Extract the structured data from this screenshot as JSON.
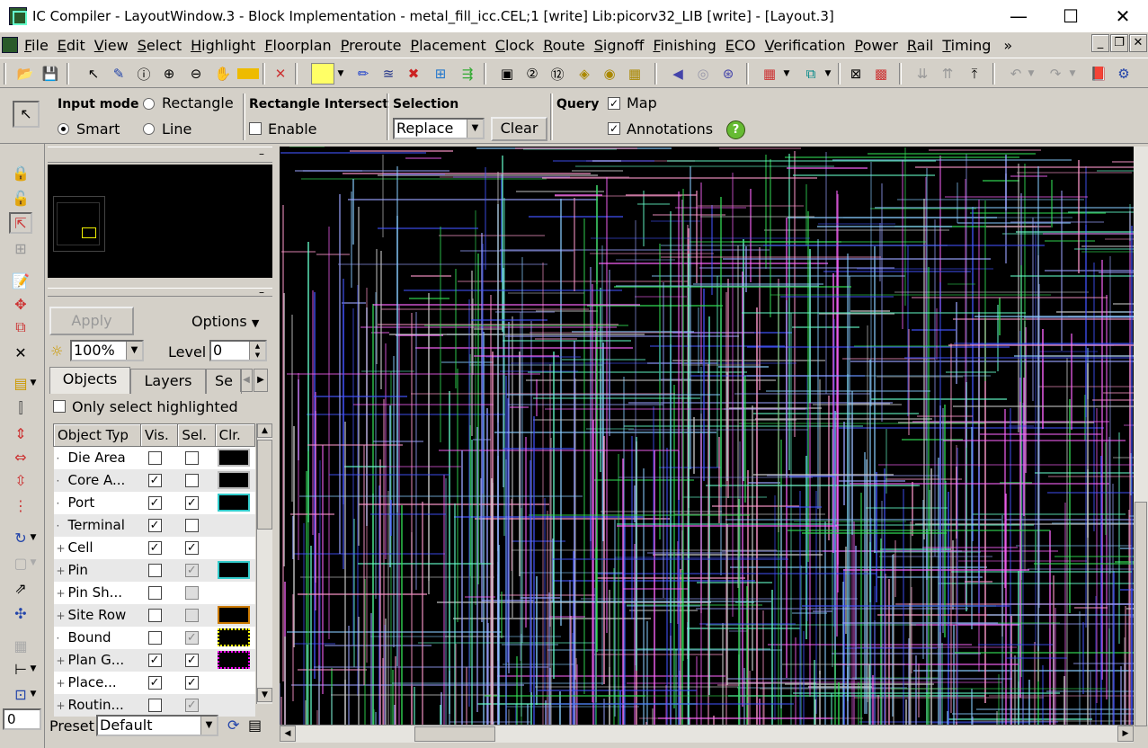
{
  "window": {
    "title": "IC Compiler - LayoutWindow.3 - Block Implementation - metal_fill_icc.CEL;1 [write]    Lib:picorv32_LIB [write] - [Layout.3]",
    "minimize": "—",
    "maximize": "☐",
    "close": "✕"
  },
  "menubar": {
    "items": [
      "File",
      "Edit",
      "View",
      "Select",
      "Highlight",
      "Floorplan",
      "Preroute",
      "Placement",
      "Clock",
      "Route",
      "Signoff",
      "Finishing",
      "ECO",
      "Verification",
      "Power",
      "Rail",
      "Timing"
    ],
    "overflow": "»"
  },
  "mdi_controls": {
    "minimize": "_",
    "restore": "❐",
    "close": "✕"
  },
  "options_bar": {
    "input_mode_label": "Input mode",
    "rectangle": "Rectangle",
    "smart": "Smart",
    "line": "Line",
    "rect_intersect_label": "Rectangle Intersect",
    "enable": "Enable",
    "selection_label": "Selection",
    "selection_value": "Replace",
    "clear": "Clear",
    "query_label": "Query",
    "map": "Map",
    "annotations": "Annotations",
    "help": "?"
  },
  "panel": {
    "apply": "Apply",
    "options": "Options",
    "brightness": "100%",
    "level_label": "Level",
    "level_value": "0",
    "tabs": [
      "Objects",
      "Layers",
      "Se"
    ],
    "only_select_highlighted": "Only select highlighted",
    "columns": [
      "Object Typ",
      "Vis.",
      "Sel.",
      "Clr."
    ],
    "rows": [
      {
        "prefix": "·",
        "name": "Die Area",
        "vis": false,
        "sel": false,
        "sel_dis": false,
        "color": "#000000",
        "border": "#bbbbbb"
      },
      {
        "prefix": "·",
        "name": "Core A...",
        "vis": true,
        "sel": false,
        "sel_dis": false,
        "color": "#000000",
        "border": "#bbbbbb"
      },
      {
        "prefix": "·",
        "name": "Port",
        "vis": true,
        "sel": true,
        "sel_dis": false,
        "color": "#000000",
        "border": "#33cccc"
      },
      {
        "prefix": "·",
        "name": "Terminal",
        "vis": true,
        "sel": false,
        "sel_dis": false,
        "color": "",
        "border": ""
      },
      {
        "prefix": "+",
        "name": "Cell",
        "vis": true,
        "sel": true,
        "sel_dis": false,
        "color": "",
        "border": ""
      },
      {
        "prefix": "+",
        "name": "Pin",
        "vis": false,
        "sel": true,
        "sel_dis": true,
        "color": "#000000",
        "border": "#33cccc"
      },
      {
        "prefix": "+",
        "name": "Pin Sh...",
        "vis": false,
        "sel": false,
        "sel_dis": true,
        "color": "",
        "border": ""
      },
      {
        "prefix": "+",
        "name": "Site Row",
        "vis": false,
        "sel": false,
        "sel_dis": true,
        "color": "#000000",
        "border": "#cc7a00"
      },
      {
        "prefix": "·",
        "name": "Bound",
        "vis": false,
        "sel": true,
        "sel_dis": true,
        "color": "#000000",
        "border": "#ffff00"
      },
      {
        "prefix": "+",
        "name": "Plan G...",
        "vis": true,
        "sel": true,
        "sel_dis": false,
        "color": "#000000",
        "border": "#ff00ff"
      },
      {
        "prefix": "+",
        "name": "Place...",
        "vis": true,
        "sel": true,
        "sel_dis": false,
        "color": "",
        "border": ""
      },
      {
        "prefix": "+",
        "name": "Routin...",
        "vis": false,
        "sel": true,
        "sel_dis": true,
        "color": "",
        "border": ""
      }
    ],
    "preset_label": "Preset",
    "preset_value": "Default",
    "coord_value": "0"
  },
  "colors": {
    "chrome": "#d4d0c8",
    "canvas": "#000000",
    "wire_colors": [
      "#9aa4ff",
      "#ff66ff",
      "#66ffcc",
      "#33dd55",
      "#cccccc",
      "#4455ff",
      "#ff99cc",
      "#88ccff"
    ]
  }
}
